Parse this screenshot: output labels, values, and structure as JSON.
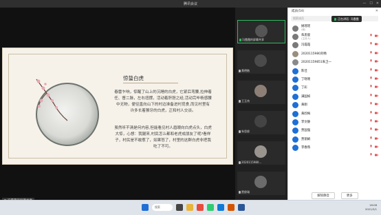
{
  "titlebar": {
    "title": "腾讯会议"
  },
  "slide": {
    "title": "惊蛰白虎",
    "p1": [
      "春雷乍响，惊醒了山上的沉睡的白虎，它紧后弯腰,拉伸着",
      "任、督二脉，左右扭摆，活动着肝胆之经,活动完毕杨感腰",
      "中无物，便径直向山下的村边准备进村觅食,而见村里有",
      "许多长着獠牙的白虎，正和村人交谈。"
    ],
    "p2": [
      "虽然听不清是何内容,但能看见村人眉眼向白虎点头，白虎",
      "大惊，心想：我腿来,村民怎么都和老虎成朋友了呢?看样",
      "子，村民是不敢惹了，如果怒了，村里的这群白虎非把我",
      "吃了不可。"
    ]
  },
  "share_label": "冯霞霞的屏幕共享",
  "video_tiles": [
    {
      "name": "冯霞霞的屏幕共享",
      "active": true
    },
    {
      "name": "黄德楷",
      "active": false
    },
    {
      "name": "王玉伟",
      "active": false
    },
    {
      "name": "朱思俊",
      "active": false
    },
    {
      "name": "2020115980...",
      "active": false
    },
    {
      "name": "贾俊瑞",
      "active": false
    }
  ],
  "panel": {
    "header": "成员(54)",
    "search_placeholder": "搜索成员",
    "speaking": "正在讲话: 冯霞霞",
    "members": [
      {
        "name": "姚瑶瑶",
        "sub": "(我)",
        "color": "#7a7a7a"
      },
      {
        "name": "朱思俊",
        "sub": "(主持人)",
        "color": "#7a7a7a"
      },
      {
        "name": "冯霞霞",
        "sub": "",
        "color": "#7a7a7a"
      },
      {
        "name": "2020115980刘畅",
        "sub": "",
        "color": "#9a8e80"
      },
      {
        "name": "20201159851朱卫一",
        "sub": "",
        "color": "#8a8a8a"
      },
      {
        "name": "陈佳",
        "sub": "",
        "color": "#1f6fd6"
      },
      {
        "name": "丁晓晓",
        "sub": "",
        "color": "#1f6fd6"
      },
      {
        "name": "丁彩",
        "sub": "",
        "color": "#1f6fd6"
      },
      {
        "name": "满国如",
        "sub": "",
        "color": "#1f6fd6"
      },
      {
        "name": "黄刚",
        "sub": "",
        "color": "#1f6fd6"
      },
      {
        "name": "黄欣梅",
        "sub": "",
        "color": "#1f6fd6"
      },
      {
        "name": "李文静",
        "sub": "",
        "color": "#1f6fd6"
      },
      {
        "name": "贾国强",
        "sub": "",
        "color": "#1f6fd6"
      },
      {
        "name": "贾丽娟",
        "sub": "",
        "color": "#1f6fd6"
      },
      {
        "name": "李春燕",
        "sub": "",
        "color": "#1f6fd6"
      }
    ],
    "btn_unmute": "解除静音",
    "btn_more": "更多"
  },
  "taskbar": {
    "search": "搜索",
    "time": "16:08",
    "date": "2021/3/1"
  }
}
